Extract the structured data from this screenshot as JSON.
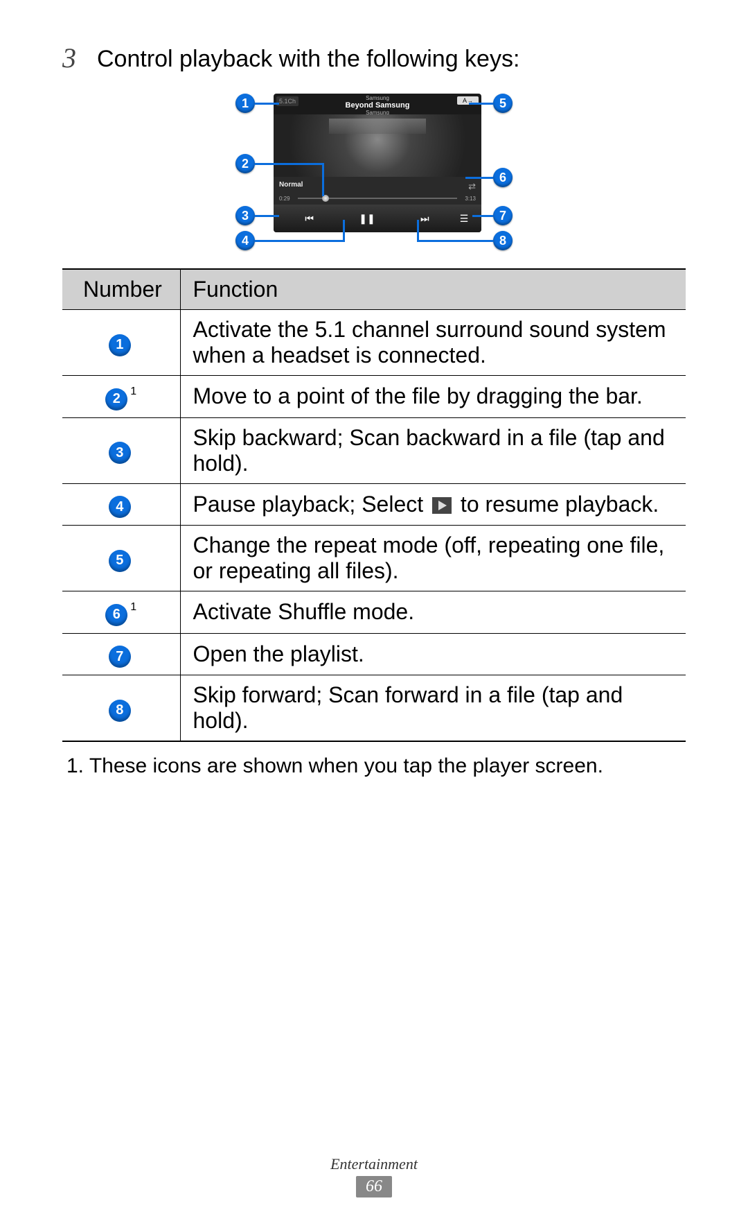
{
  "step": {
    "number": "3",
    "text": "Control playback with the following keys:"
  },
  "player": {
    "artist_top": "Samsung",
    "track": "Beyond Samsung",
    "album": "Samsung",
    "surround_label": "5.1Ch",
    "repeat_label": "A",
    "eq_label": "Normal",
    "time_elapsed": "0:29",
    "time_total": "3:13"
  },
  "callouts": {
    "c1": "1",
    "c2": "2",
    "c3": "3",
    "c4": "4",
    "c5": "5",
    "c6": "6",
    "c7": "7",
    "c8": "8"
  },
  "table": {
    "headers": {
      "number": "Number",
      "function": "Function"
    },
    "rows": [
      {
        "num": "1",
        "sup": "",
        "func_a": "Activate the 5.1 channel surround sound system when a headset is connected.",
        "func_b": ""
      },
      {
        "num": "2",
        "sup": "1",
        "func_a": "Move to a point of the file by dragging the bar.",
        "func_b": ""
      },
      {
        "num": "3",
        "sup": "",
        "func_a": "Skip backward; Scan backward in a file (tap and hold).",
        "func_b": ""
      },
      {
        "num": "4",
        "sup": "",
        "func_a": "Pause playback; Select ",
        "func_b": " to resume playback."
      },
      {
        "num": "5",
        "sup": "",
        "func_a": "Change the repeat mode (off, repeating one file, or repeating all files).",
        "func_b": ""
      },
      {
        "num": "6",
        "sup": "1",
        "func_a": "Activate Shuffle mode.",
        "func_b": ""
      },
      {
        "num": "7",
        "sup": "",
        "func_a": "Open the playlist.",
        "func_b": ""
      },
      {
        "num": "8",
        "sup": "",
        "func_a": "Skip forward; Scan forward in a file (tap and hold).",
        "func_b": ""
      }
    ]
  },
  "footnote": "1.  These icons are shown when you tap the player screen.",
  "footer": {
    "section": "Entertainment",
    "page": "66"
  }
}
